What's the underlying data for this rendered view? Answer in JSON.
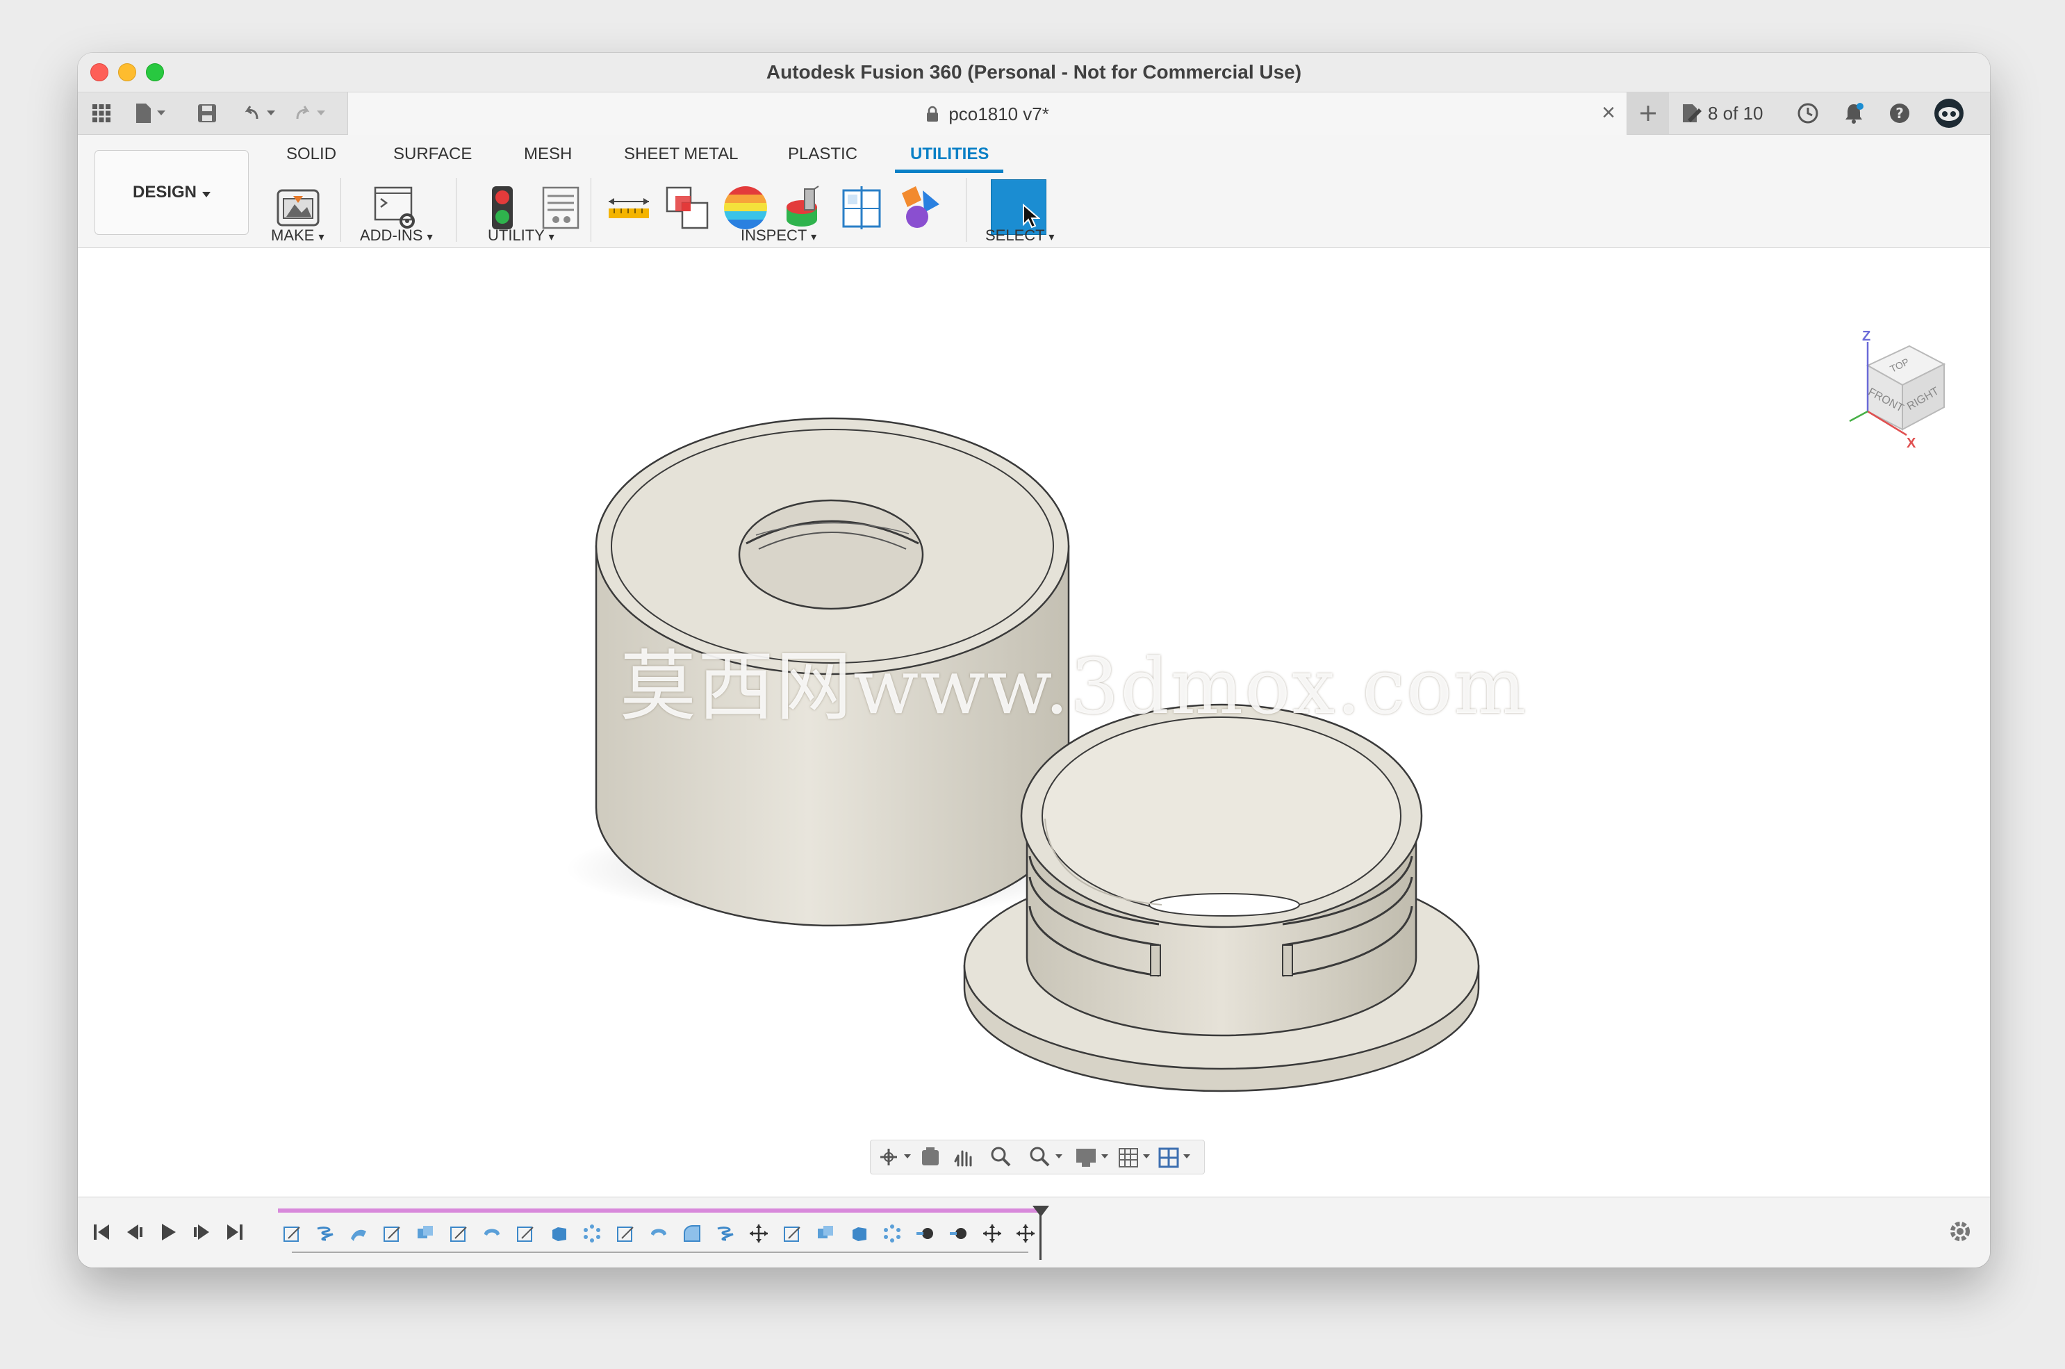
{
  "window": {
    "title": "Autodesk Fusion 360 (Personal - Not for Commercial Use)"
  },
  "tabbar": {
    "doc_title": "pco1810 v7*",
    "close_glyph": "×",
    "count_label": "8 of 10",
    "icons": [
      "apps-grid-icon",
      "file-menu-icon",
      "save-icon",
      "undo-icon",
      "redo-icon",
      "new-tab-icon",
      "job-status-icon",
      "notifications-icon",
      "help-icon",
      "user-avatar-icon"
    ]
  },
  "ribbon": {
    "workspace": "DESIGN",
    "tabs": [
      "SOLID",
      "SURFACE",
      "MESH",
      "SHEET METAL",
      "PLASTIC",
      "UTILITIES"
    ],
    "active_tab": "UTILITIES",
    "groups": [
      "MAKE",
      "ADD-INS",
      "UTILITY",
      "INSPECT",
      "SELECT"
    ],
    "accent_color": "#0a80c6"
  },
  "viewport": {
    "watermark": "莫西网www.3dmox.com",
    "viewcube": {
      "top": "TOP",
      "front": "FRONT",
      "right": "RIGHT",
      "axis_z": "Z",
      "axis_x": "X"
    },
    "model_color": "#e3dfd3"
  },
  "timeline": {
    "controls": [
      "first-frame-icon",
      "prev-step-icon",
      "play-icon",
      "next-step-icon",
      "last-frame-icon"
    ],
    "feature_count": 23
  }
}
